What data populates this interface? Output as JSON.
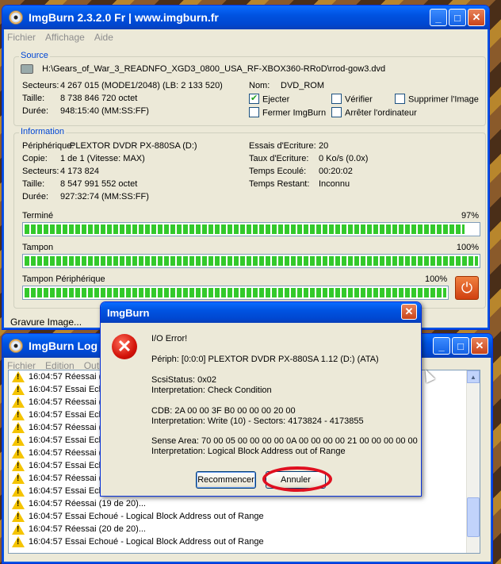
{
  "main_window": {
    "title": "ImgBurn 2.3.2.0 Fr | www.imgburn.fr",
    "menu": [
      "Fichier",
      "Affichage",
      "Aide"
    ],
    "source": {
      "legend": "Source",
      "path": "H:\\Gears_of_War_3_READNFO_XGD3_0800_USA_RF-XBOX360-RRoD\\rrod-gow3.dvd",
      "secteurs_label": "Secteurs:",
      "secteurs_value": "4 267 015 (MODE1/2048) (LB: 2 133 520)",
      "taille_label": "Taille:",
      "taille_value": "8 738 846 720 octet",
      "duree_label": "Durée:",
      "duree_value": "948:15:40 (MM:SS:FF)",
      "nom_label": "Nom:",
      "nom_value": "DVD_ROM",
      "options": [
        {
          "label": "Ejecter",
          "checked": true
        },
        {
          "label": "Vérifier",
          "checked": false
        },
        {
          "label": "Supprimer l'Image",
          "checked": false
        },
        {
          "label": "Fermer ImgBurn",
          "checked": false
        },
        {
          "label": "Arrêter l'ordinateur",
          "checked": false
        }
      ]
    },
    "information": {
      "legend": "Information",
      "peripherique_label": "Périphérique:",
      "peripherique_value": "PLEXTOR DVDR PX-880SA (D:)",
      "copie_label": "Copie:",
      "copie_value": "1 de 1 (Vitesse: MAX)",
      "secteurs_label": "Secteurs:",
      "secteurs_value": "4 173 824",
      "taille_label": "Taille:",
      "taille_value": "8 547 991 552 octet",
      "duree_label": "Durée:",
      "duree_value": "927:32:74 (MM:SS:FF)",
      "essais_label": "Essais d'Ecriture:",
      "essais_value": "20",
      "taux_label": "Taux d'Ecriture:",
      "taux_value": "0 Ko/s (0.0x)",
      "ecoule_label": "Temps Ecoulé:",
      "ecoule_value": "00:20:02",
      "restant_label": "Temps Restant:",
      "restant_value": "Inconnu",
      "progress": [
        {
          "label": "Terminé",
          "percent_text": "97%",
          "fraction": 0.97
        },
        {
          "label": "Tampon",
          "percent_text": "100%",
          "fraction": 1.0
        },
        {
          "label": "Tampon Périphérique",
          "percent_text": "100%",
          "fraction": 1.0
        }
      ]
    },
    "status": "Gravure Image..."
  },
  "log_window": {
    "title": "ImgBurn Log",
    "menu": [
      "Fichier",
      "Edition",
      "Outi"
    ],
    "lines": [
      "16:04:57 Réessai (",
      "16:04:57 Essai Echo",
      "16:04:57 Réessai (",
      "16:04:57 Essai Ech",
      "16:04:57 Réessai (",
      "16:04:57 Essai Ech",
      "16:04:57 Réessai (",
      "16:04:57 Essai Echo",
      "16:04:57 Réessai (",
      "16:04:57 Essai Echo",
      "16:04:57 Réessai (19 de 20)...",
      "16:04:57 Essai Echoué - Logical Block Address out of Range",
      "16:04:57 Réessai (20 de 20)...",
      "16:04:57 Essai Echoué - Logical Block Address out of Range"
    ]
  },
  "dialog": {
    "title": "ImgBurn",
    "lines": [
      "I/O Error!",
      "Périph: [0:0:0] PLEXTOR DVDR   PX-880SA 1.12 (D:) (ATA)",
      "ScsiStatus: 0x02",
      "Interpretation: Check Condition",
      "CDB: 2A 00 00 3F B0 00 00 00 20 00",
      "Interpretation: Write (10) - Sectors: 4173824 - 4173855",
      "Sense Area: 70 00 05 00 00 00 00 0A 00 00 00 00 21 00 00 00 00 00",
      "Interpretation: Logical Block Address out of Range"
    ],
    "retry_label": "Recommencer",
    "cancel_label": "Annuler"
  }
}
